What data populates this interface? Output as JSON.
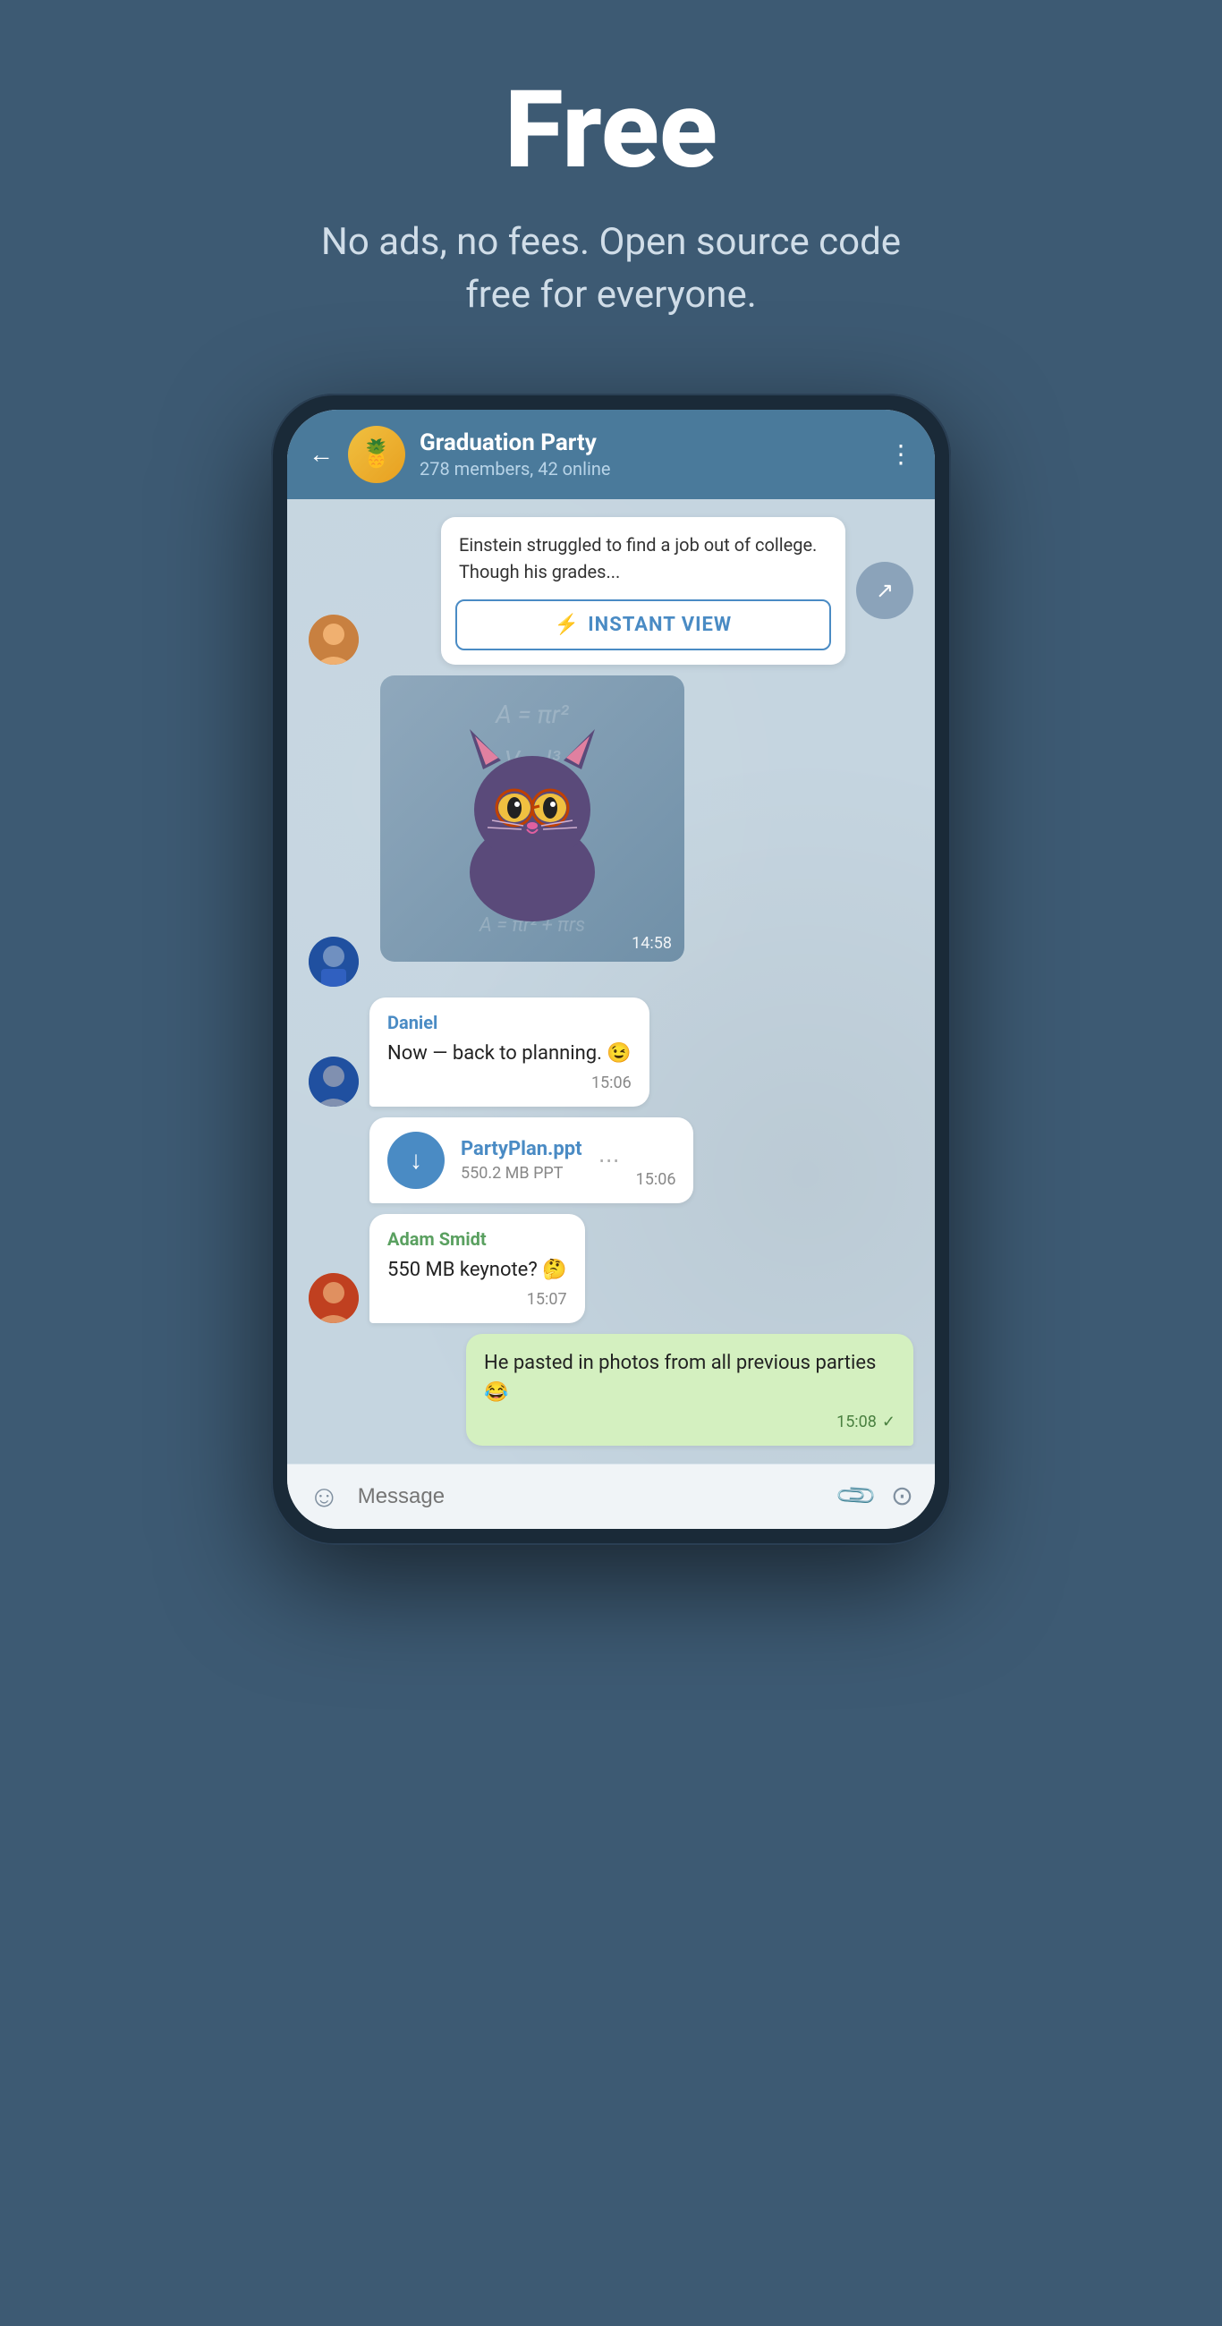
{
  "hero": {
    "title": "Free",
    "subtitle": "No ads, no fees. Open source code free for everyone."
  },
  "chat": {
    "name": "Graduation Party",
    "status": "278 members, 42 online",
    "avatar_emoji": "🍍"
  },
  "article": {
    "text": "Einstein struggled to find a job out of college. Though his grades...",
    "instant_view_label": "INSTANT VIEW"
  },
  "sticker": {
    "time": "14:58",
    "math_bg": "A = πr²   l = πr\nV = l³\nP = 2πr\nA = πr²\ns = √(r² + h²)\nA = πr² + πrs"
  },
  "messages": [
    {
      "id": "daniel-msg",
      "sender": "Daniel",
      "text": "Now — back to planning. 😉",
      "time": "15:06",
      "type": "left",
      "avatar": "boy1"
    },
    {
      "id": "file-msg",
      "file_name": "PartyPlan.ppt",
      "file_size": "550.2 MB PPT",
      "time": "15:06",
      "type": "file"
    },
    {
      "id": "adam-msg",
      "sender": "Adam Smidt",
      "text": "550 MB keynote? 🤔",
      "time": "15:07",
      "type": "left",
      "avatar": "boy3"
    },
    {
      "id": "own-msg",
      "text": "He pasted in photos from all previous parties 😂",
      "time": "15:08",
      "type": "right"
    }
  ],
  "input_bar": {
    "placeholder": "Message"
  },
  "icons": {
    "back": "←",
    "more": "⋮",
    "share": "↗",
    "lightning": "⚡",
    "download": "↓",
    "emoji": "☺",
    "attach": "📎",
    "camera": "⊙",
    "check": "✓"
  }
}
